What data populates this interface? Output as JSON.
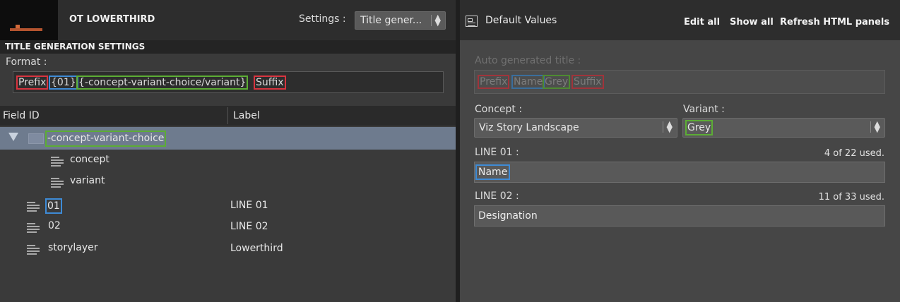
{
  "left_header": {
    "title": "OT LOWERTHIRD",
    "settings_label": "Settings :",
    "settings_value": "Title gener..."
  },
  "right_header": {
    "title": "Default Values",
    "edit_all": "Edit all",
    "show_all": "Show all",
    "refresh": "Refresh HTML panels"
  },
  "settings": {
    "section_title": "TITLE GENERATION SETTINGS",
    "format_label": "Format :",
    "format_tokens": [
      {
        "text": "Prefix",
        "color": "#d8343f"
      },
      {
        "text": "{01}",
        "color": "#3e8bd6"
      },
      {
        "text": "{-concept-variant-choice/variant}",
        "color": "#5cad35"
      },
      {
        "text": "Suffix",
        "color": "#d8343f"
      }
    ]
  },
  "tree": {
    "col_field": "Field ID",
    "col_label": "Label",
    "rows": [
      {
        "id": "-concept-variant-choice",
        "label": ""
      },
      {
        "id": "concept",
        "label": ""
      },
      {
        "id": "variant",
        "label": ""
      },
      {
        "id": "01",
        "label": "LINE 01"
      },
      {
        "id": "02",
        "label": "LINE 02"
      },
      {
        "id": "storylayer",
        "label": "Lowerthird"
      }
    ]
  },
  "form": {
    "auto_title_label": "Auto generated title :",
    "auto_tokens": [
      {
        "text": "Prefix",
        "color": "#a0343b"
      },
      {
        "text": "Name",
        "color": "#3a6e9c"
      },
      {
        "text": "Grey",
        "color": "#4e8a31"
      },
      {
        "text": "Suffix",
        "color": "#a0343b"
      }
    ],
    "concept_label": "Concept :",
    "concept_value": "Viz Story Landscape",
    "variant_label": "Variant :",
    "variant_value": "Grey",
    "line01_label": "LINE 01 :",
    "line01_count": "4 of 22 used.",
    "line01_value": "Name",
    "line02_label": "LINE 02 :",
    "line02_count": "11 of 33 used.",
    "line02_value": "Designation"
  },
  "icons": [
    "thumbnail",
    "stepper-icon",
    "panel-icon",
    "triangle-down-icon",
    "folder-icon",
    "document-icon"
  ]
}
